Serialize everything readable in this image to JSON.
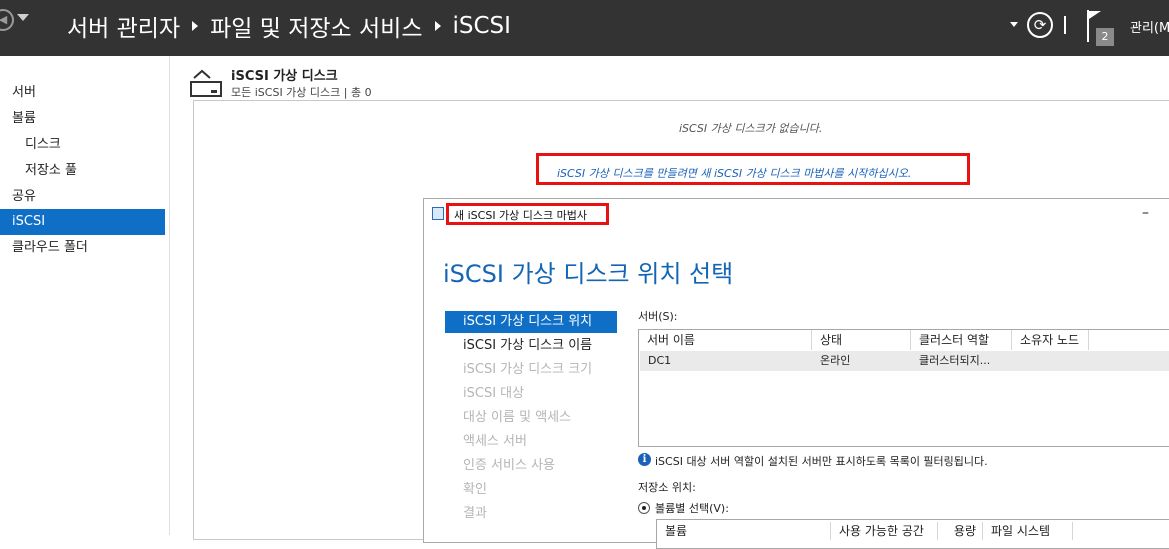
{
  "header": {
    "breadcrumbs": [
      "서버 관리자",
      "파일 및 저장소 서비스",
      "iSCSI"
    ],
    "notification_count": "2",
    "manage_menu": "관리(M"
  },
  "sidebar": {
    "items": [
      {
        "label": "서버"
      },
      {
        "label": "볼륨"
      },
      {
        "label": "디스크"
      },
      {
        "label": "저장소 풀"
      },
      {
        "label": "공유"
      },
      {
        "label": "iSCSI"
      },
      {
        "label": "클라우드 폴더"
      }
    ],
    "selected": "iSCSI"
  },
  "pane": {
    "title": "iSCSI 가상 디스크",
    "subtitle": "모든 iSCSI 가상 디스크 | 총 0",
    "empty_message": "iSCSI 가상 디스크가 없습니다.",
    "start_wizard_link": "iSCSI 가상 디스크를 만들려면 새 iSCSI 가상 디스크 마법사를 시작하십시오."
  },
  "wizard": {
    "window_title": "새 iSCSI 가상 디스크 마법사",
    "minimize_glyph": "–",
    "heading": "iSCSI 가상 디스크 위치 선택",
    "steps": [
      {
        "label": "iSCSI 가상 디스크 위치",
        "state": "active"
      },
      {
        "label": "iSCSI 가상 디스크 이름",
        "state": "enabled"
      },
      {
        "label": "iSCSI 가상 디스크 크기",
        "state": "disabled"
      },
      {
        "label": "iSCSI 대상",
        "state": "disabled"
      },
      {
        "label": "대상 이름 및 액세스",
        "state": "disabled"
      },
      {
        "label": "액세스 서버",
        "state": "disabled"
      },
      {
        "label": "인증 서비스 사용",
        "state": "disabled"
      },
      {
        "label": "확인",
        "state": "disabled"
      },
      {
        "label": "결과",
        "state": "disabled"
      }
    ],
    "server_label": "서버(S):",
    "server_columns": [
      "서버 이름",
      "상태",
      "클러스터 역할",
      "소유자 노드"
    ],
    "server_rows": [
      [
        "DC1",
        "온라인",
        "클러스터되지...",
        ""
      ]
    ],
    "info_text": "iSCSI 대상 서버 역할이 설치된 서버만 표시하도록 목록이 필터링됩니다.",
    "storage_label": "저장소 위치:",
    "radio_option": "볼륨별 선택(V):",
    "volume_columns": [
      "볼륨",
      "사용 가능한 공간",
      "용량",
      "파일 시스템"
    ]
  },
  "colors": {
    "accent": "#0f6fc6",
    "highlight_box": "#e81212",
    "header_bg": "#333333"
  }
}
